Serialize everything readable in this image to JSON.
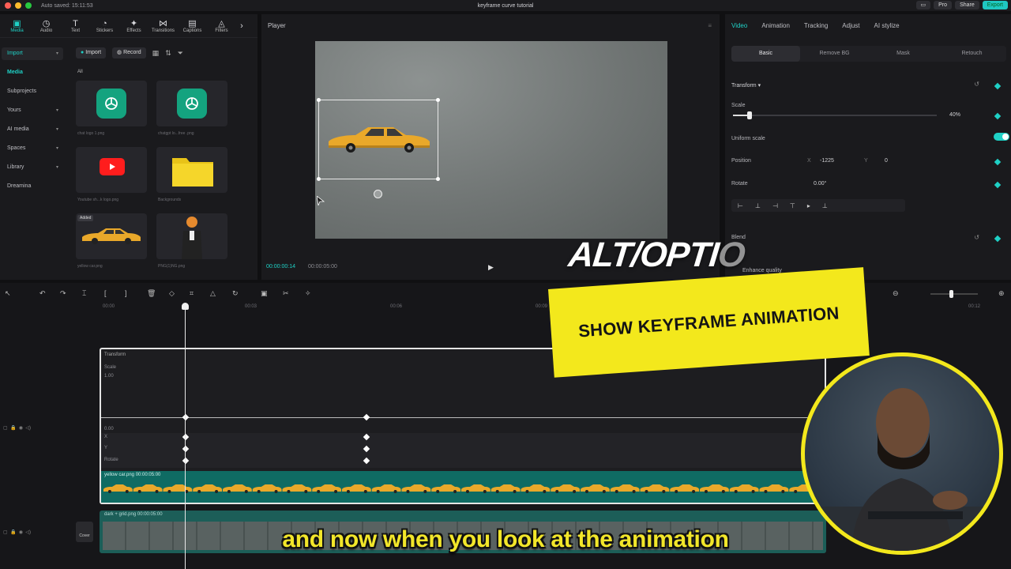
{
  "window": {
    "title": "keyframe curve tutorial",
    "autosave": "Auto saved: 15:11:53",
    "pro_label": "Pro",
    "share_label": "Share",
    "export_label": "Export"
  },
  "toolbar": {
    "items": [
      {
        "label": "Media",
        "icon": "media-icon"
      },
      {
        "label": "Audio",
        "icon": "audio-icon"
      },
      {
        "label": "Text",
        "icon": "text-icon"
      },
      {
        "label": "Stickers",
        "icon": "stickers-icon"
      },
      {
        "label": "Effects",
        "icon": "effects-icon"
      },
      {
        "label": "Transitions",
        "icon": "transitions-icon"
      },
      {
        "label": "Captions",
        "icon": "captions-icon"
      },
      {
        "label": "Filters",
        "icon": "filters-icon"
      }
    ]
  },
  "sidebar": {
    "items": [
      "Import",
      "Media",
      "Subprojects",
      "Yours",
      "AI media",
      "Spaces",
      "Library",
      "Dreamina"
    ]
  },
  "media": {
    "import_label": "Import",
    "record_label": "Record",
    "filter_all": "All",
    "thumbs": [
      {
        "caption": "chat logo 1.png"
      },
      {
        "caption": "chatgpt lo...free .png"
      },
      {
        "caption": "Youtube sh...k logo.png"
      },
      {
        "caption": "Backgrounds"
      },
      {
        "caption": "yellow car.png",
        "tag": "Added"
      },
      {
        "caption": "PNG(1)NG.png"
      }
    ]
  },
  "player": {
    "title": "Player",
    "current_time": "00:00:00:14",
    "total_time": "00:00:05:00"
  },
  "inspector": {
    "tabs": [
      "Video",
      "Animation",
      "Tracking",
      "Adjust",
      "AI stylize"
    ],
    "subtabs": [
      "Basic",
      "Remove BG",
      "Mask",
      "Retouch"
    ],
    "transform_label": "Transform",
    "scale_label": "Scale",
    "scale_value": "40%",
    "uniform_scale_label": "Uniform scale",
    "position_label": "Position",
    "position_x_label": "X",
    "position_x": "-1225",
    "position_y_label": "Y",
    "position_y": "0",
    "rotate_label": "Rotate",
    "rotate_value": "0.00°",
    "blend_label": "Blend",
    "enhance_label": "Enhance quality"
  },
  "timeline": {
    "ruler": [
      "00:00",
      "00:03",
      "00:06",
      "00:09",
      "00:12"
    ],
    "transform_label": "Transform",
    "scale_label": "Scale",
    "scale_top": "1.00",
    "scale_bottom": "0.00",
    "x_label": "X",
    "y_label": "Y",
    "rotate_label": "Rotate",
    "clip_name": "yellow car.png  00:00:05:00",
    "bg_clip_name": "dark + grid.png  00:00:05:00",
    "cover_label": "Cover"
  },
  "overlays": {
    "alt_text": "ALT/OPTI",
    "alt_tail": "O",
    "banner": "SHOW KEYFRAME ANIMATION",
    "subtitle": "and now when you look at the animation"
  },
  "colors": {
    "accent": "#1fd1c6",
    "banner": "#f3e81c",
    "subtitle": "#f2e62a"
  }
}
